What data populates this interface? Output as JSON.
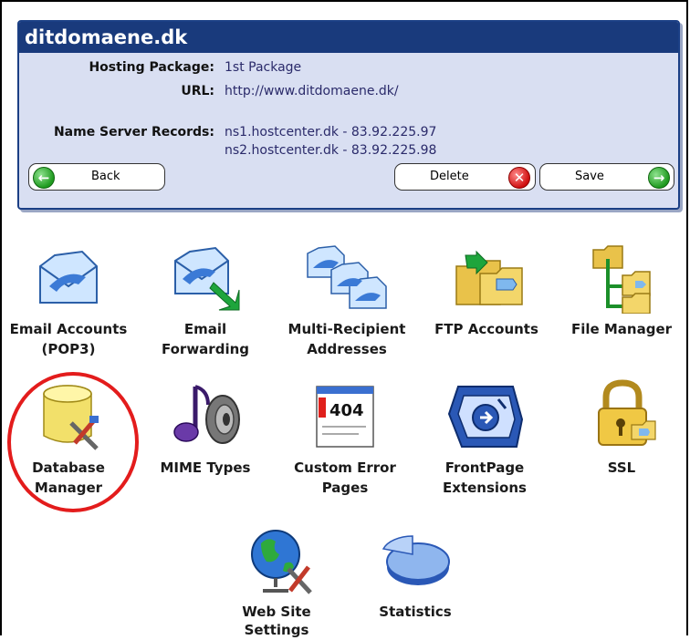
{
  "panel": {
    "title": "ditdomaene.dk",
    "hosting_label": "Hosting Package:",
    "hosting_value": "1st Package",
    "url_label": "URL:",
    "url_value": "http://www.ditdomaene.dk/",
    "ns_label": "Name Server Records:",
    "ns_values": [
      "ns1.hostcenter.dk - 83.92.225.97",
      "ns2.hostcenter.dk - 83.92.225.98"
    ]
  },
  "buttons": {
    "back": "Back",
    "delete": "Delete",
    "save": "Save"
  },
  "tiles": [
    {
      "line1": "Email Accounts",
      "line2": "(POP3)",
      "icon": "email-accounts-icon"
    },
    {
      "line1": "Email",
      "line2": "Forwarding",
      "icon": "email-forwarding-icon"
    },
    {
      "line1": "Multi-Recipient",
      "line2": "Addresses",
      "icon": "multi-recipient-icon"
    },
    {
      "line1": "FTP Accounts",
      "line2": "",
      "icon": "ftp-folder-icon"
    },
    {
      "line1": "File Manager",
      "line2": "",
      "icon": "file-manager-icon"
    },
    {
      "line1": "Database",
      "line2": "Manager",
      "icon": "database-icon"
    },
    {
      "line1": "MIME Types",
      "line2": "",
      "icon": "mime-music-icon"
    },
    {
      "line1": "Custom Error",
      "line2": "Pages",
      "icon": "error-404-icon"
    },
    {
      "line1": "FrontPage",
      "line2": "Extensions",
      "icon": "frontpage-icon"
    },
    {
      "line1": "SSL",
      "line2": "",
      "icon": "lock-icon"
    },
    {
      "line1": "Web Site",
      "line2": "Settings",
      "icon": "globe-settings-icon"
    },
    {
      "line1": "Statistics",
      "line2": "",
      "icon": "pie-chart-icon"
    }
  ],
  "badge_404": "404",
  "colors": {
    "header": "#193a7c",
    "panel_bg": "#d9dff2",
    "highlight": "#e31c1c"
  }
}
